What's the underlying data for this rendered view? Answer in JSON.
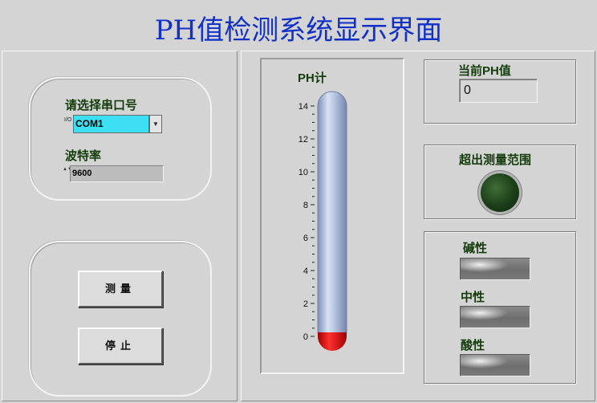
{
  "window": {
    "title": "PH值检测系统显示界面"
  },
  "serial": {
    "port_label": "请选择串口号",
    "port_value": "COM1",
    "port_index_glyph": "I/O",
    "dropdown_glyph": "▼",
    "baud_label": "波特率",
    "baud_value": "9600",
    "spin_glyph": "▲▼"
  },
  "buttons": {
    "measure": "测量",
    "stop": "停止"
  },
  "meter": {
    "label": "PH计",
    "scale_min": 0,
    "scale_max": 14,
    "tick_labels": [
      "14",
      "12",
      "10",
      "8",
      "6",
      "4",
      "2",
      "0"
    ],
    "value": 0,
    "colors": {
      "tube": "#a9b8d8",
      "bulb": "#e00000"
    }
  },
  "readout": {
    "label": "当前PH值",
    "value": "0"
  },
  "alarm": {
    "label": "超出测量范围",
    "state": "off",
    "color": "#1c3e18"
  },
  "status": {
    "alkaline": "碱性",
    "neutral": "中性",
    "acidic": "酸性"
  },
  "colors": {
    "title": "#1030c8",
    "label": "#143c0a",
    "combo_bg": "#3ce0f2"
  }
}
